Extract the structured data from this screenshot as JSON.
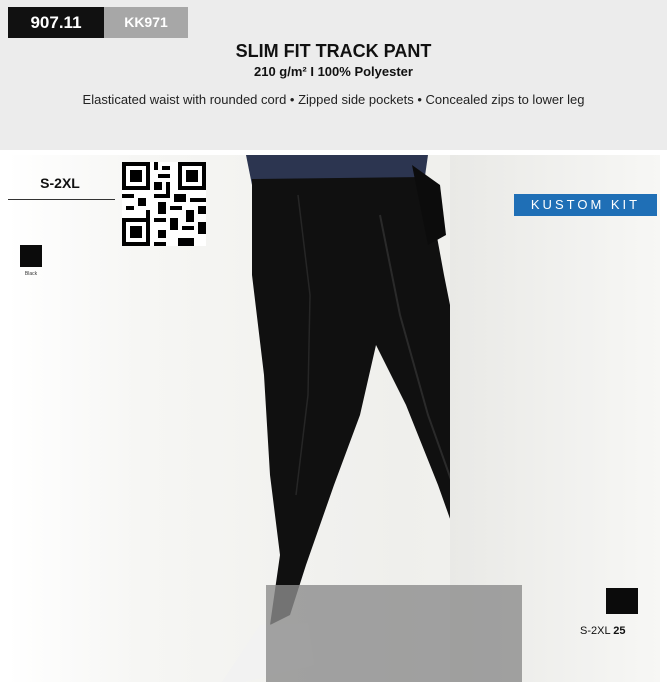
{
  "product": {
    "code": "907.11",
    "ref": "KK971",
    "name": "SLIM FIT TRACK PANT",
    "spec": "210 g/m² I 100% Polyester",
    "features": "Elasticated waist with rounded cord • Zipped side pockets • Concealed zips to lower leg"
  },
  "sizes": "S-2XL",
  "colors": [
    {
      "name": "Black",
      "hex": "#0b0b0b"
    }
  ],
  "brand": "KUSTOM KIT",
  "packaging": {
    "size": "S-2XL",
    "quantity": "25"
  }
}
